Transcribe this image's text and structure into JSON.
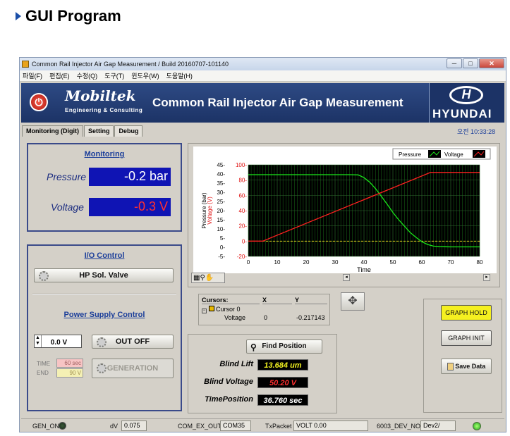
{
  "slide": {
    "title": "GUI Program"
  },
  "window": {
    "title": "Common Rail Injector Air Gap Measurement / Build 20160707-101140",
    "menu": [
      "파일(F)",
      "편집(E)",
      "수정(Q)",
      "도구(T)",
      "윈도우(W)",
      "도움말(H)"
    ],
    "controls": {
      "minimize": "─",
      "maximize": "□",
      "close": "✕"
    }
  },
  "header": {
    "logo": "Mobiltek",
    "logo_sub": "Engineering & Consulting",
    "title": "Common Rail Injector Air Gap Measurement",
    "brand_mark": "H",
    "brand": "HYUNDAI",
    "power_icon": "power-icon"
  },
  "tabs": [
    "Monitoring (Digit)",
    "Setting",
    "Debug"
  ],
  "clock": "오전 10:33:28",
  "monitoring": {
    "title": "Monitoring",
    "pressure_label": "Pressure",
    "pressure_value": "-0.2 bar",
    "voltage_label": "Voltage",
    "voltage_value": "-0.3 V"
  },
  "io_control": {
    "title": "I/O Control",
    "valve_button": "HP Sol. Valve",
    "power_title": "Power Supply Control",
    "voltage_setting": "0.0 V",
    "out_button": "OUT OFF",
    "time_label": "TIME",
    "time_value": "60 sec",
    "end_label": "END",
    "end_value": "90 V",
    "generation_button": "GENERATION"
  },
  "chart_legend": {
    "pressure": "Pressure",
    "voltage": "Voltage"
  },
  "chart_data": {
    "type": "line",
    "xlabel": "Time",
    "ylabel_left": "Pressure (bar)",
    "ylabel_right": "Voltage (V)",
    "xlim": [
      0,
      80
    ],
    "ylim_left": [
      -5,
      45
    ],
    "ylim_right": [
      -20,
      100
    ],
    "x_ticks": [
      0,
      10,
      20,
      30,
      40,
      50,
      60,
      70,
      80
    ],
    "y_ticks_left": [
      45,
      40,
      35,
      30,
      25,
      20,
      15,
      10,
      5,
      0,
      -5
    ],
    "y_ticks_right": [
      100,
      80,
      60,
      40,
      20,
      0,
      -20
    ],
    "grid": true,
    "legend": "top-right",
    "series": [
      {
        "name": "Pressure",
        "axis": "left",
        "color": "#19e619",
        "x": [
          0,
          10,
          20,
          30,
          35,
          38,
          40,
          42,
          44,
          46,
          48,
          50,
          52,
          54,
          56,
          58,
          60,
          62,
          64,
          66,
          70,
          80
        ],
        "y": [
          39.6,
          39.6,
          39.6,
          39.6,
          39.6,
          39.5,
          38.0,
          35.5,
          32.0,
          27.8,
          23.5,
          19.0,
          15.0,
          11.5,
          8.0,
          5.4,
          3.0,
          1.5,
          0.6,
          0.3,
          0.2,
          0.2
        ]
      },
      {
        "name": "Voltage",
        "axis": "right",
        "color": "#ff2020",
        "x": [
          0,
          5,
          63,
          65,
          80
        ],
        "y": [
          0,
          0,
          90,
          90,
          90
        ]
      }
    ]
  },
  "cursors": {
    "header": "Cursors:",
    "col_x": "X",
    "col_y": "Y",
    "name": "Cursor 0",
    "series": "Voltage",
    "x": "0",
    "y": "-0.217143"
  },
  "position": {
    "find_button": "Find Position",
    "blind_lift_label": "Blind Lift",
    "blind_lift_value": "13.684 um",
    "blind_voltage_label": "Blind Voltage",
    "blind_voltage_value": "50.20 V",
    "time_position_label": "TimePosition",
    "time_position_value": "36.760 sec"
  },
  "graph_controls": {
    "hold": "GRAPH HOLD",
    "init": "GRAPH INIT",
    "save": "Save Data"
  },
  "status": {
    "gen_on": "GEN_ON",
    "dv_label": "dV",
    "dv_value": "0.075",
    "com_label": "COM_EX_OUT",
    "com_value": "COM35",
    "tx_label": "TxPacket",
    "tx_value": "VOLT 0.00",
    "dev_label": "6003_DEV_NO",
    "dev_value": "Dev2/"
  }
}
